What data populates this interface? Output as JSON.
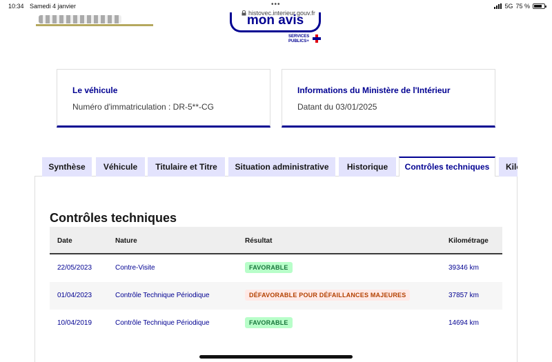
{
  "status_bar": {
    "time": "10:34",
    "date": "Samedi 4 janvier",
    "url": "histovec.interieur.gouv.fr",
    "network": "5G",
    "battery": "75 %",
    "battery_level": 0.75
  },
  "header": {
    "brand": "mon avis",
    "services_publics_line1": "SERVICES",
    "services_publics_line2": "PUBLICS+"
  },
  "cards": {
    "vehicle": {
      "title": "Le véhicule",
      "value": "Numéro d'immatriculation : DR-5**-CG"
    },
    "ministry": {
      "title": "Informations du Ministère de l'Intérieur",
      "value": "Datant du 03/01/2025"
    }
  },
  "tabs": [
    {
      "label": "Synthèse"
    },
    {
      "label": "Véhicule"
    },
    {
      "label": "Titulaire et Titre"
    },
    {
      "label": "Situation administrative"
    },
    {
      "label": "Historique"
    },
    {
      "label": "Contrôles techniques",
      "active": true
    },
    {
      "label": "Kilométrage"
    }
  ],
  "section": {
    "title": "Contrôles techniques"
  },
  "table": {
    "headers": [
      "Date",
      "Nature",
      "Résultat",
      "Kilométrage"
    ],
    "rows": [
      {
        "date": "22/05/2023",
        "nature": "Contre-Visite",
        "result": "FAVORABLE",
        "result_status": "ok",
        "km": "39346 km"
      },
      {
        "date": "01/04/2023",
        "nature": "Contrôle Technique Périodique",
        "result": "DÉFAVORABLE POUR DÉFAILLANCES MAJEURES",
        "result_status": "ko",
        "km": "37857 km"
      },
      {
        "date": "10/04/2019",
        "nature": "Contrôle Technique Périodique",
        "result": "FAVORABLE",
        "result_status": "ok",
        "km": "14694 km"
      }
    ]
  },
  "colors": {
    "primary": "#000091",
    "tab_bg": "#e3e3fd",
    "success_bg": "#b8fec9",
    "success_text": "#18753c",
    "error_bg": "#ffe9e6",
    "error_text": "#b34000"
  }
}
